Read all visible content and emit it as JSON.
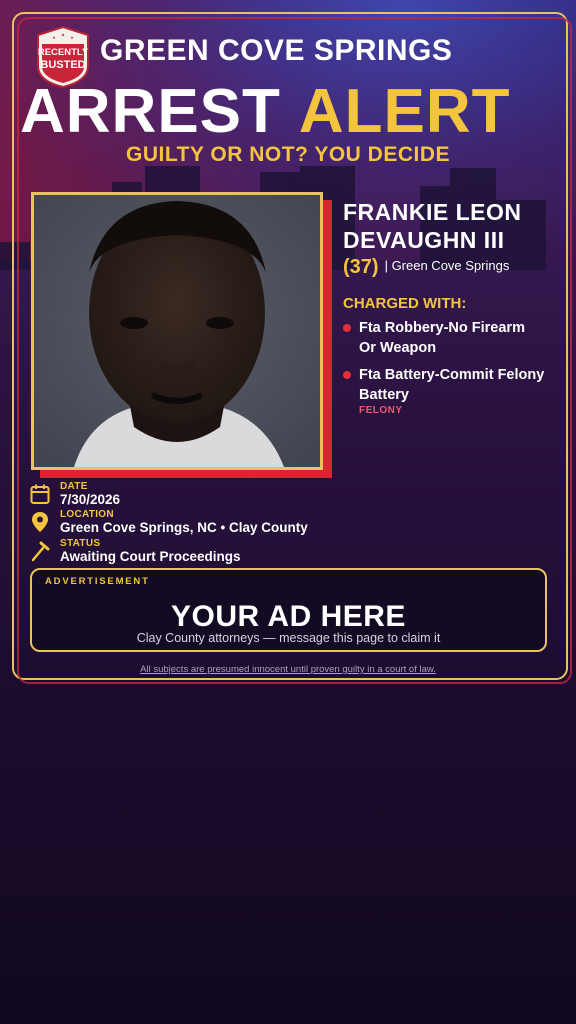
{
  "badge": {
    "line1": "RECENTLY",
    "line2": "BUSTED"
  },
  "header": {
    "city": "GREEN COVE SPRINGS",
    "headline_word1": "ARREST",
    "headline_word2": "ALERT",
    "tagline": "GUILTY OR NOT? YOU DECIDE"
  },
  "subject": {
    "name_line1": "FRANKIE LEON",
    "name_line2": "DEVAUGHN III",
    "age": "(37)",
    "location_short": "| Green Cove Springs"
  },
  "charges": {
    "label": "CHARGED WITH:",
    "items": [
      {
        "line1": "Fta Robbery-No Firearm",
        "line2": "Or Weapon"
      },
      {
        "line1": "Fta Battery-Commit Felony",
        "line2": "Battery"
      }
    ],
    "severity": "FELONY"
  },
  "info": {
    "date_label": "DATE",
    "date_value": "7/30/2026",
    "location_label": "LOCATION",
    "location_value": "Green Cove Springs, NC • Clay County",
    "status_label": "STATUS",
    "status_value": "Awaiting Court Proceedings"
  },
  "ad": {
    "label": "ADVERTISEMENT",
    "title": "YOUR AD HERE",
    "subtitle": "Clay County attorneys — message this page to claim it"
  },
  "footer": {
    "disclaimer": "All subjects are presumed innocent until proven guilty in a court of law."
  },
  "colors": {
    "gold": "#f2c53d",
    "red": "#d7262f",
    "navy": "#2b1f6a",
    "felony": "#ee5a6a"
  }
}
